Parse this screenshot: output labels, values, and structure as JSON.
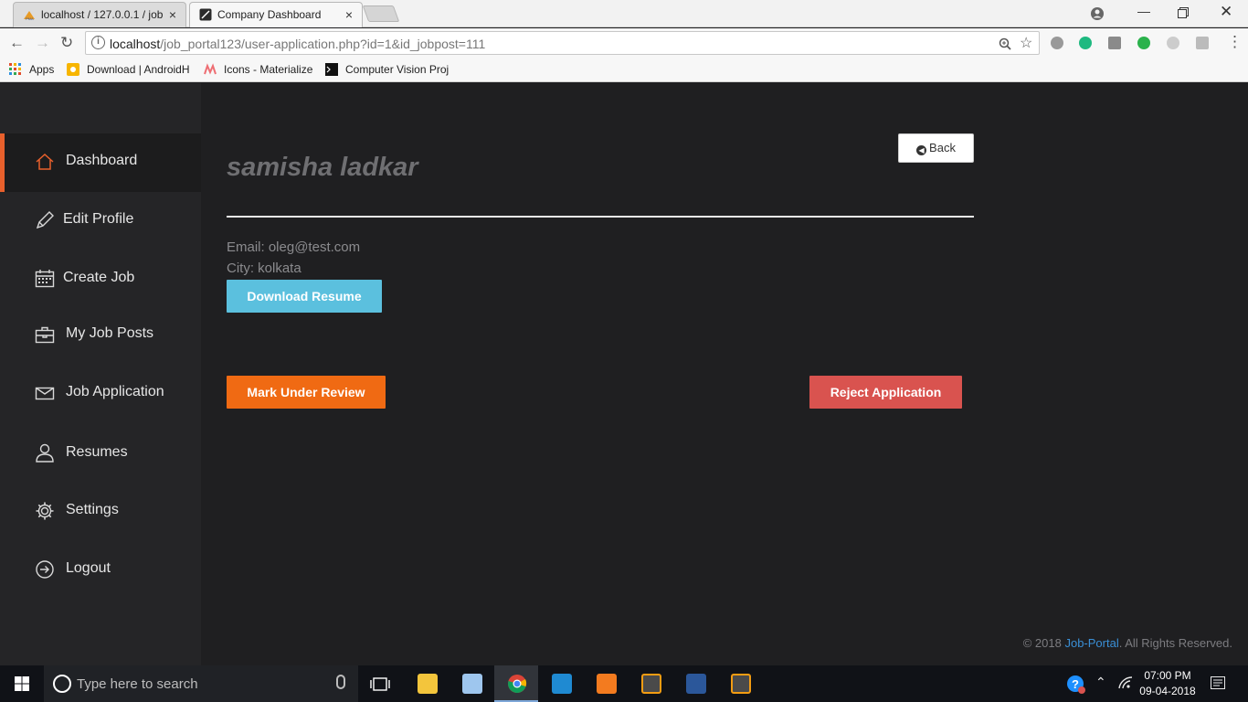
{
  "browser": {
    "tabs": [
      {
        "title": "localhost / 127.0.0.1 / job",
        "active": false
      },
      {
        "title": "Company Dashboard",
        "active": true
      }
    ],
    "close_glyph": "×",
    "url_host": "localhost",
    "url_path": "/job_portal123/user-application.php?id=1&id_jobpost=111",
    "bookmarks": [
      {
        "label": "Apps",
        "icon": "apps-grid-icon"
      },
      {
        "label": "Download | AndroidH",
        "icon": "androidhive-icon"
      },
      {
        "label": "Icons - Materialize",
        "icon": "materialize-icon"
      },
      {
        "label": "Computer Vision Proj",
        "icon": "terminal-icon"
      }
    ]
  },
  "sidebar": {
    "items": [
      {
        "label": "Dashboard",
        "icon": "home-icon",
        "active": true
      },
      {
        "label": "Edit Profile",
        "icon": "pencil-icon",
        "active": false
      },
      {
        "label": "Create Job",
        "icon": "calendar-icon",
        "active": false
      },
      {
        "label": "My Job Posts",
        "icon": "briefcase-icon",
        "active": false
      },
      {
        "label": "Job Application",
        "icon": "envelope-icon",
        "active": false
      },
      {
        "label": "Resumes",
        "icon": "user-icon",
        "active": false
      },
      {
        "label": "Settings",
        "icon": "gear-icon",
        "active": false
      },
      {
        "label": "Logout",
        "icon": "logout-icon",
        "active": false
      }
    ]
  },
  "main": {
    "back_label": "Back",
    "applicant_name": "samisha ladkar",
    "email_line": "Email: oleg@test.com",
    "city_line": "City: kolkata",
    "download_resume_label": "Download Resume",
    "mark_review_label": "Mark Under Review",
    "reject_label": "Reject Application"
  },
  "footer": {
    "prefix": "© 2018 ",
    "link": "Job-Portal",
    "suffix": ". All Rights Reserved."
  },
  "taskbar": {
    "search_placeholder": "Type here to search",
    "time": "07:00 PM",
    "date": "09-04-2018"
  },
  "colors": {
    "accent_orange": "#f06a13",
    "info_blue": "#5bc0de",
    "danger_red": "#d9534f",
    "sidebar_active_border": "#e8602c"
  }
}
